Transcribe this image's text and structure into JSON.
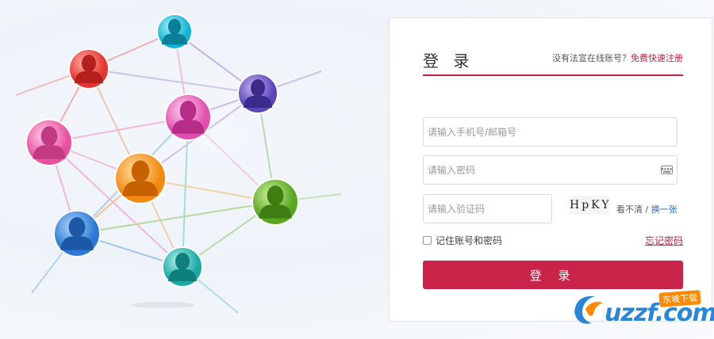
{
  "login": {
    "title": "登 录",
    "no_account_text": "没有法宣在线账号？",
    "register_link": "免费快速注册",
    "username_placeholder": "请输入手机号/邮箱号",
    "password_placeholder": "请输入密码",
    "captcha_placeholder": "请输入验证码",
    "captcha_code": "HpKY",
    "captcha_unclear": "看不清 / ",
    "captcha_change": "换一张",
    "remember_label": "记住账号和密码",
    "forgot_label": "忘记密码",
    "submit_label": "登 录"
  },
  "watermark": {
    "brand": "uzzf.com",
    "badge": "东坡下载"
  },
  "colors": {
    "accent": "#c9234a",
    "link": "#2a6ac2"
  }
}
